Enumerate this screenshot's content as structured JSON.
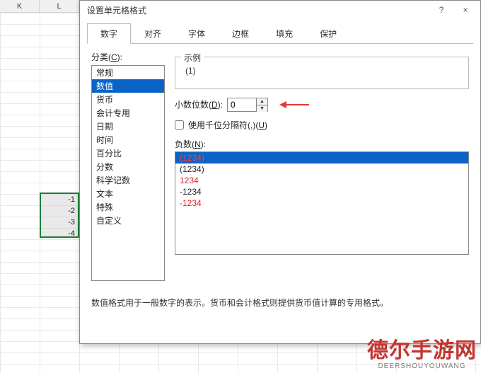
{
  "sheet": {
    "col_headers": [
      "K",
      "L"
    ],
    "selected_values": [
      "-1",
      "-2",
      "-3",
      "-4"
    ]
  },
  "dialog": {
    "title": "设置单元格格式",
    "help_tip": "?",
    "close_tip": "×",
    "tabs": [
      {
        "label": "数字",
        "active": true
      },
      {
        "label": "对齐",
        "active": false
      },
      {
        "label": "字体",
        "active": false
      },
      {
        "label": "边框",
        "active": false
      },
      {
        "label": "填充",
        "active": false
      },
      {
        "label": "保护",
        "active": false
      }
    ],
    "category_label_prefix": "分类(",
    "category_label_u": "C",
    "category_label_suffix": "):",
    "categories": [
      {
        "label": "常规",
        "selected": false
      },
      {
        "label": "数值",
        "selected": true
      },
      {
        "label": "货币",
        "selected": false
      },
      {
        "label": "会计专用",
        "selected": false
      },
      {
        "label": "日期",
        "selected": false
      },
      {
        "label": "时间",
        "selected": false
      },
      {
        "label": "百分比",
        "selected": false
      },
      {
        "label": "分数",
        "selected": false
      },
      {
        "label": "科学记数",
        "selected": false
      },
      {
        "label": "文本",
        "selected": false
      },
      {
        "label": "特殊",
        "selected": false
      },
      {
        "label": "自定义",
        "selected": false
      }
    ],
    "sample_title": "示例",
    "sample_value": "(1)",
    "decimal_label_prefix": "小数位数(",
    "decimal_label_u": "D",
    "decimal_label_suffix": "):",
    "decimal_value": "0",
    "thousands_label_prefix": "使用千位分隔符(,)(",
    "thousands_label_u": "U",
    "thousands_label_suffix": ")",
    "thousands_checked": false,
    "negative_label_prefix": "负数(",
    "negative_label_u": "N",
    "negative_label_suffix": "):",
    "negatives": [
      {
        "text": "(1234)",
        "color": "red",
        "selected": true
      },
      {
        "text": "(1234)",
        "color": "black",
        "selected": false
      },
      {
        "text": "1234",
        "color": "red",
        "selected": false
      },
      {
        "text": "-1234",
        "color": "black",
        "selected": false
      },
      {
        "text": "-1234",
        "color": "red",
        "selected": false
      }
    ],
    "description": "数值格式用于一般数字的表示。货币和会计格式则提供货币值计算的专用格式。"
  },
  "watermark": {
    "zh": "德尔手游网",
    "en": "DEERSHOUYOUWANG"
  }
}
